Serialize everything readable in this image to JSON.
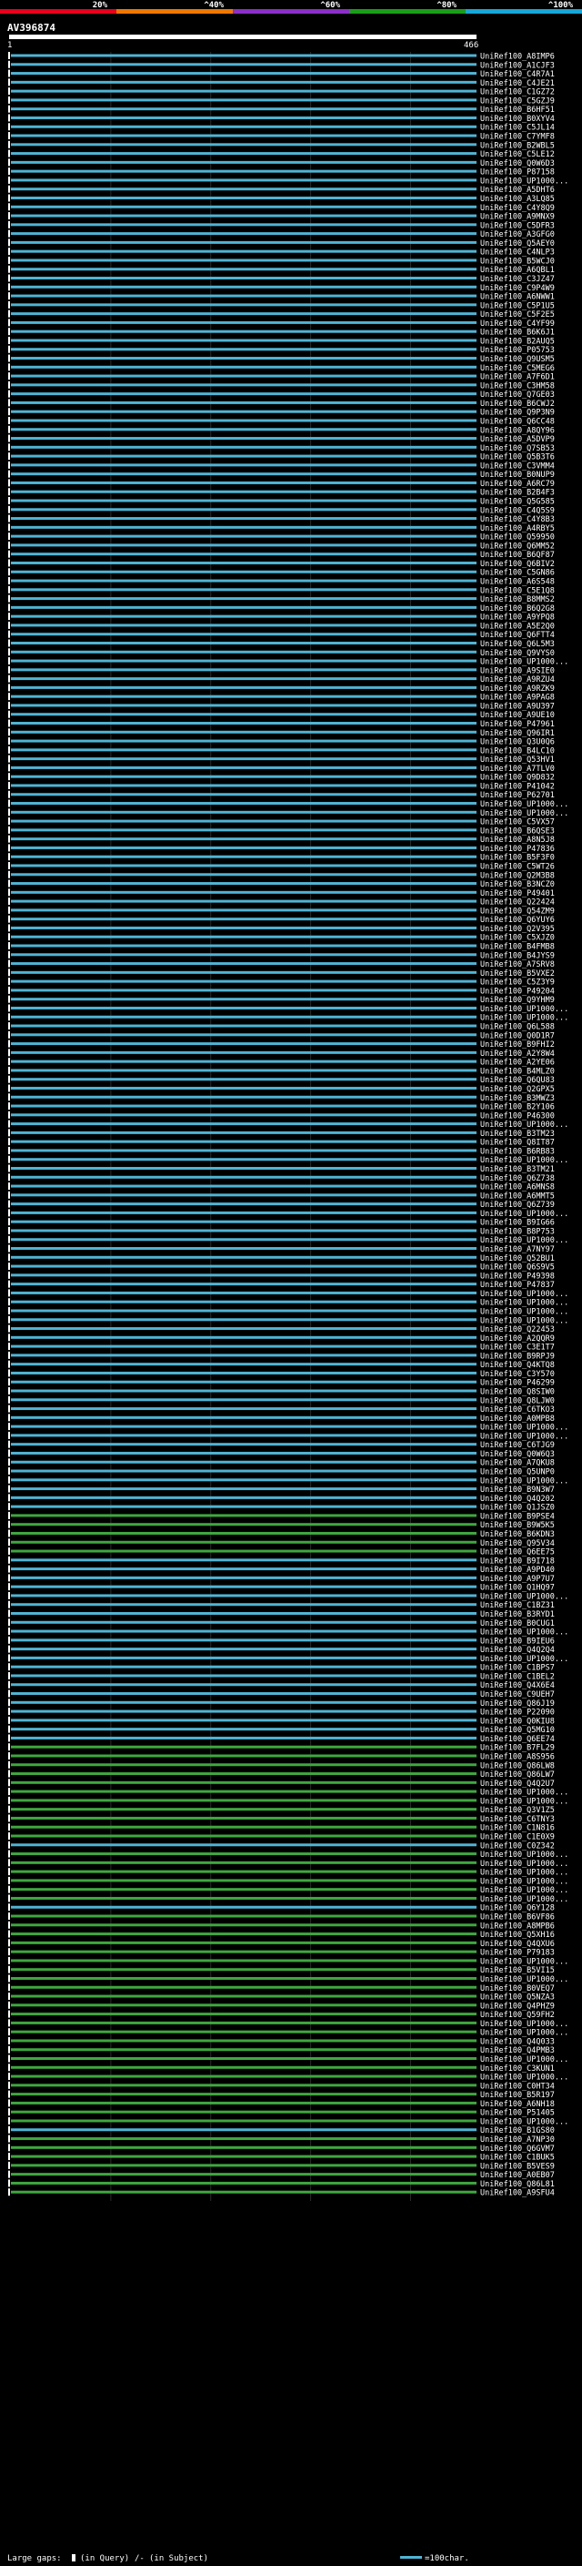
{
  "chart_data": {
    "type": "bar",
    "title": "AV396874",
    "query_start_label": "1",
    "query_end_label": "466",
    "query_length": 466,
    "identity_scale": {
      "labels": [
        "20%",
        "^40%",
        "^60%",
        "^80%",
        "^100%"
      ],
      "colors": [
        "#e8001c",
        "#f07800",
        "#8b2fc9",
        "#1a9e1a",
        "#16a8d8"
      ]
    },
    "bar_color_teal": "#4fb4d4",
    "bar_color_green": "#3fa73f",
    "bar_color_gray": "#9a9a9a",
    "legend": {
      "large_gaps": "Large gaps:",
      "in_query": "(in Query)",
      "in_subject": "(in Subject)",
      "scale": "=100char."
    },
    "hits": [
      {
        "label": "UniRef100_A8IMP6",
        "c": "t"
      },
      {
        "label": "UniRef100_A1CJF3",
        "c": "t"
      },
      {
        "label": "UniRef100_C4R7A1",
        "c": "t"
      },
      {
        "label": "UniRef100_C4JE21",
        "c": "t"
      },
      {
        "label": "UniRef100_C1GZ72",
        "c": "t"
      },
      {
        "label": "UniRef100_C5GZJ9",
        "c": "t"
      },
      {
        "label": "UniRef100_B6HF51",
        "c": "t"
      },
      {
        "label": "UniRef100_B0XYV4",
        "c": "t"
      },
      {
        "label": "UniRef100_C5JL14",
        "c": "t"
      },
      {
        "label": "UniRef100_C7YMF8",
        "c": "t"
      },
      {
        "label": "UniRef100_B2WBL5",
        "c": "t"
      },
      {
        "label": "UniRef100_C5LE12",
        "c": "t"
      },
      {
        "label": "UniRef100_Q0W6D3",
        "c": "t"
      },
      {
        "label": "UniRef100_P87158",
        "c": "t"
      },
      {
        "label": "UniRef100_UP1000...",
        "c": "t"
      },
      {
        "label": "UniRef100_A5DHT6",
        "c": "t"
      },
      {
        "label": "UniRef100_A3LQ85",
        "c": "t"
      },
      {
        "label": "UniRef100_C4Y8Q9",
        "c": "t"
      },
      {
        "label": "UniRef100_A9MNX9",
        "c": "t"
      },
      {
        "label": "UniRef100_C5DFR3",
        "c": "t"
      },
      {
        "label": "UniRef100_A3GFG0",
        "c": "t"
      },
      {
        "label": "UniRef100_Q5AEY0",
        "c": "t"
      },
      {
        "label": "UniRef100_C4NLP3",
        "c": "t"
      },
      {
        "label": "UniRef100_B5WCJ0",
        "c": "t"
      },
      {
        "label": "UniRef100_A6QBL1",
        "c": "t"
      },
      {
        "label": "UniRef100_C3JZ47",
        "c": "t"
      },
      {
        "label": "UniRef100_C9P4W9",
        "c": "t"
      },
      {
        "label": "UniRef100_A6NWW1",
        "c": "t"
      },
      {
        "label": "UniRef100_C5P1U5",
        "c": "t"
      },
      {
        "label": "UniRef100_C5F2E5",
        "c": "t"
      },
      {
        "label": "UniRef100_C4YF99",
        "c": "t"
      },
      {
        "label": "UniRef100_B6K6J1",
        "c": "t"
      },
      {
        "label": "UniRef100_B2AUQ5",
        "c": "t"
      },
      {
        "label": "UniRef100_P05753",
        "c": "t"
      },
      {
        "label": "UniRef100_Q9USM5",
        "c": "t"
      },
      {
        "label": "UniRef100_C5MEG6",
        "c": "t"
      },
      {
        "label": "UniRef100_A7F6D1",
        "c": "t"
      },
      {
        "label": "UniRef100_C3HM58",
        "c": "t"
      },
      {
        "label": "UniRef100_Q7GE03",
        "c": "t"
      },
      {
        "label": "UniRef100_B6CWJ2",
        "c": "t"
      },
      {
        "label": "UniRef100_Q9P3N9",
        "c": "t"
      },
      {
        "label": "UniRef100_Q6CC48",
        "c": "t"
      },
      {
        "label": "UniRef100_A8QY96",
        "c": "t"
      },
      {
        "label": "UniRef100_A5DVP9",
        "c": "t"
      },
      {
        "label": "UniRef100_Q7SB53",
        "c": "t"
      },
      {
        "label": "UniRef100_Q5B3T6",
        "c": "t"
      },
      {
        "label": "UniRef100_C3VMM4",
        "c": "t"
      },
      {
        "label": "UniRef100_B0NUP9",
        "c": "t"
      },
      {
        "label": "UniRef100_A6RC79",
        "c": "t"
      },
      {
        "label": "UniRef100_B2B4F3",
        "c": "t"
      },
      {
        "label": "UniRef100_Q5G585",
        "c": "t"
      },
      {
        "label": "UniRef100_C4Q5S9",
        "c": "t"
      },
      {
        "label": "UniRef100_C4Y8B3",
        "c": "t"
      },
      {
        "label": "UniRef100_A4RBY5",
        "c": "t"
      },
      {
        "label": "UniRef100_Q59950",
        "c": "t"
      },
      {
        "label": "UniRef100_Q6MM52",
        "c": "t"
      },
      {
        "label": "UniRef100_B6QF87",
        "c": "t"
      },
      {
        "label": "UniRef100_Q6BIV2",
        "c": "t"
      },
      {
        "label": "UniRef100_C5GN86",
        "c": "t"
      },
      {
        "label": "UniRef100_A6S548",
        "c": "t"
      },
      {
        "label": "UniRef100_C5E1Q8",
        "c": "t"
      },
      {
        "label": "UniRef100_B8MMS2",
        "c": "t"
      },
      {
        "label": "UniRef100_B6Q2G8",
        "c": "t"
      },
      {
        "label": "UniRef100_A9YPQ8",
        "c": "t"
      },
      {
        "label": "UniRef100_A5E2Q0",
        "c": "t"
      },
      {
        "label": "UniRef100_Q6FTT4",
        "c": "t"
      },
      {
        "label": "UniRef100_Q6L5M3",
        "c": "t"
      },
      {
        "label": "UniRef100_Q9VYS0",
        "c": "t"
      },
      {
        "label": "UniRef100_UP1000...",
        "c": "t"
      },
      {
        "label": "UniRef100_A9SIE0",
        "c": "t"
      },
      {
        "label": "UniRef100_A9RZU4",
        "c": "t"
      },
      {
        "label": "UniRef100_A9RZK9",
        "c": "t"
      },
      {
        "label": "UniRef100_A9PAG8",
        "c": "t"
      },
      {
        "label": "UniRef100_A9U397",
        "c": "t"
      },
      {
        "label": "UniRef100_A9UE10",
        "c": "t"
      },
      {
        "label": "UniRef100_P47961",
        "c": "t"
      },
      {
        "label": "UniRef100_Q96IR1",
        "c": "t"
      },
      {
        "label": "UniRef100_Q3U0Q6",
        "c": "t"
      },
      {
        "label": "UniRef100_B4LC10",
        "c": "t"
      },
      {
        "label": "UniRef100_Q53HV1",
        "c": "t"
      },
      {
        "label": "UniRef100_A7TLV0",
        "c": "t"
      },
      {
        "label": "UniRef100_Q9D832",
        "c": "t"
      },
      {
        "label": "UniRef100_P41042",
        "c": "t"
      },
      {
        "label": "UniRef100_P62701",
        "c": "t"
      },
      {
        "label": "UniRef100_UP1000...",
        "c": "t"
      },
      {
        "label": "UniRef100_UP1000...",
        "c": "t"
      },
      {
        "label": "UniRef100_C5VX57",
        "c": "t"
      },
      {
        "label": "UniRef100_B6QSE3",
        "c": "t"
      },
      {
        "label": "UniRef100_A8N5J8",
        "c": "t"
      },
      {
        "label": "UniRef100_P47836",
        "c": "t"
      },
      {
        "label": "UniRef100_B5F3F0",
        "c": "t"
      },
      {
        "label": "UniRef100_C5WT26",
        "c": "t"
      },
      {
        "label": "UniRef100_Q2M3B8",
        "c": "t"
      },
      {
        "label": "UniRef100_B3NCZ0",
        "c": "t"
      },
      {
        "label": "UniRef100_P49401",
        "c": "t"
      },
      {
        "label": "UniRef100_Q22424",
        "c": "t"
      },
      {
        "label": "UniRef100_Q54ZM9",
        "c": "t"
      },
      {
        "label": "UniRef100_Q6YUY6",
        "c": "t"
      },
      {
        "label": "UniRef100_Q2V395",
        "c": "t"
      },
      {
        "label": "UniRef100_C5XJZ0",
        "c": "t"
      },
      {
        "label": "UniRef100_B4FMB8",
        "c": "t"
      },
      {
        "label": "UniRef100_B4JYS9",
        "c": "t"
      },
      {
        "label": "UniRef100_A7SRV8",
        "c": "t"
      },
      {
        "label": "UniRef100_B5VXE2",
        "c": "t"
      },
      {
        "label": "UniRef100_C5Z3Y9",
        "c": "t"
      },
      {
        "label": "UniRef100_P49204",
        "c": "t"
      },
      {
        "label": "UniRef100_Q9YHM9",
        "c": "t"
      },
      {
        "label": "UniRef100_UP1000...",
        "c": "t"
      },
      {
        "label": "UniRef100_UP1000...",
        "c": "t"
      },
      {
        "label": "UniRef100_Q6L588",
        "c": "t"
      },
      {
        "label": "UniRef100_Q0D1R7",
        "c": "t"
      },
      {
        "label": "UniRef100_B9FHI2",
        "c": "t"
      },
      {
        "label": "UniRef100_A2Y8W4",
        "c": "t"
      },
      {
        "label": "UniRef100_A2YE06",
        "c": "t"
      },
      {
        "label": "UniRef100_B4MLZ0",
        "c": "t"
      },
      {
        "label": "UniRef100_Q6QU83",
        "c": "t"
      },
      {
        "label": "UniRef100_Q2GPX5",
        "c": "t"
      },
      {
        "label": "UniRef100_B3MWZ3",
        "c": "t"
      },
      {
        "label": "UniRef100_B2Y106",
        "c": "t"
      },
      {
        "label": "UniRef100_P46300",
        "c": "t"
      },
      {
        "label": "UniRef100_UP1000...",
        "c": "t"
      },
      {
        "label": "UniRef100_B3TM23",
        "c": "t"
      },
      {
        "label": "UniRef100_Q8IT87",
        "c": "t"
      },
      {
        "label": "UniRef100_B6RB83",
        "c": "t"
      },
      {
        "label": "UniRef100_UP1000...",
        "c": "t"
      },
      {
        "label": "UniRef100_B3TM21",
        "c": "t"
      },
      {
        "label": "UniRef100_Q6Z738",
        "c": "t"
      },
      {
        "label": "UniRef100_A6MNS8",
        "c": "t"
      },
      {
        "label": "UniRef100_A6MMT5",
        "c": "t"
      },
      {
        "label": "UniRef100_Q6Z739",
        "c": "t"
      },
      {
        "label": "UniRef100_UP1000...",
        "c": "t"
      },
      {
        "label": "UniRef100_B9IG66",
        "c": "t"
      },
      {
        "label": "UniRef100_B8P753",
        "c": "t"
      },
      {
        "label": "UniRef100_UP1000...",
        "c": "t"
      },
      {
        "label": "UniRef100_A7NY97",
        "c": "t"
      },
      {
        "label": "UniRef100_Q52BU1",
        "c": "t"
      },
      {
        "label": "UniRef100_Q6S9V5",
        "c": "t"
      },
      {
        "label": "UniRef100_P49398",
        "c": "t"
      },
      {
        "label": "UniRef100_P47837",
        "c": "t"
      },
      {
        "label": "UniRef100_UP1000...",
        "c": "t"
      },
      {
        "label": "UniRef100_UP1000...",
        "c": "t"
      },
      {
        "label": "UniRef100_UP1000...",
        "c": "t"
      },
      {
        "label": "UniRef100_UP1000...",
        "c": "t"
      },
      {
        "label": "UniRef100_Q22453",
        "c": "t"
      },
      {
        "label": "UniRef100_A2QQR9",
        "c": "t"
      },
      {
        "label": "UniRef100_C3E1T7",
        "c": "t"
      },
      {
        "label": "UniRef100_B9RPJ9",
        "c": "t"
      },
      {
        "label": "UniRef100_Q4KTQ8",
        "c": "t"
      },
      {
        "label": "UniRef100_C3Y570",
        "c": "t"
      },
      {
        "label": "UniRef100_P46299",
        "c": "t"
      },
      {
        "label": "UniRef100_Q8SIW0",
        "c": "t"
      },
      {
        "label": "UniRef100_Q8LJW0",
        "c": "t"
      },
      {
        "label": "UniRef100_C6TKO3",
        "c": "t"
      },
      {
        "label": "UniRef100_A0MPB8",
        "c": "t"
      },
      {
        "label": "UniRef100_UP1000...",
        "c": "t"
      },
      {
        "label": "UniRef100_UP1000...",
        "c": "t"
      },
      {
        "label": "UniRef100_C6TJG9",
        "c": "t"
      },
      {
        "label": "UniRef100_Q0W6Q3",
        "c": "t"
      },
      {
        "label": "UniRef100_A7QKU8",
        "c": "t"
      },
      {
        "label": "UniRef100_Q5UNP0",
        "c": "t"
      },
      {
        "label": "UniRef100_UP1000...",
        "c": "t"
      },
      {
        "label": "UniRef100_B9N3W7",
        "c": "t"
      },
      {
        "label": "UniRef100_Q4Q202",
        "c": "t"
      },
      {
        "label": "UniRef100_Q1JSZ0",
        "c": "t"
      },
      {
        "label": "UniRef100_B9PSE4",
        "c": "g"
      },
      {
        "label": "UniRef100_B9W5K5",
        "c": "g"
      },
      {
        "label": "UniRef100_B6KDN3",
        "c": "g"
      },
      {
        "label": "UniRef100_Q95V34",
        "c": "g"
      },
      {
        "label": "UniRef100_Q6EE75",
        "c": "g"
      },
      {
        "label": "UniRef100_B9I718",
        "c": "t"
      },
      {
        "label": "UniRef100_A9PD40",
        "c": "t"
      },
      {
        "label": "UniRef100_A9P7U7",
        "c": "t"
      },
      {
        "label": "UniRef100_Q1HQ97",
        "c": "t"
      },
      {
        "label": "UniRef100_UP1000...",
        "c": "t"
      },
      {
        "label": "UniRef100_C1BZ31",
        "c": "t"
      },
      {
        "label": "UniRef100_B3RYD1",
        "c": "t"
      },
      {
        "label": "UniRef100_B0CUG1",
        "c": "t"
      },
      {
        "label": "UniRef100_UP1000...",
        "c": "t"
      },
      {
        "label": "UniRef100_B9IEU6",
        "c": "t"
      },
      {
        "label": "UniRef100_Q4Q2Q4",
        "c": "t"
      },
      {
        "label": "UniRef100_UP1000...",
        "c": "t"
      },
      {
        "label": "UniRef100_C1BPS7",
        "c": "t"
      },
      {
        "label": "UniRef100_C1BEL2",
        "c": "t"
      },
      {
        "label": "UniRef100_Q4X6E4",
        "c": "t"
      },
      {
        "label": "UniRef100_C9UEH7",
        "c": "t"
      },
      {
        "label": "UniRef100_Q86J19",
        "c": "t"
      },
      {
        "label": "UniRef100_P22090",
        "c": "t"
      },
      {
        "label": "UniRef100_Q0KIU8",
        "c": "t"
      },
      {
        "label": "UniRef100_Q5MG10",
        "c": "t"
      },
      {
        "label": "UniRef100_Q6EE74",
        "c": "t"
      },
      {
        "label": "UniRef100_B7FL29",
        "c": "g"
      },
      {
        "label": "UniRef100_A8S956",
        "c": "g"
      },
      {
        "label": "UniRef100_Q86LW8",
        "c": "g"
      },
      {
        "label": "UniRef100_Q86LW7",
        "c": "g"
      },
      {
        "label": "UniRef100_Q4Q2U7",
        "c": "g"
      },
      {
        "label": "UniRef100_UP1000...",
        "c": "g"
      },
      {
        "label": "UniRef100_UP1000...",
        "c": "g"
      },
      {
        "label": "UniRef100_Q3V1Z5",
        "c": "g"
      },
      {
        "label": "UniRef100_C6TNY3",
        "c": "g"
      },
      {
        "label": "UniRef100_C1N816",
        "c": "g"
      },
      {
        "label": "UniRef100_C1E0X9",
        "c": "g"
      },
      {
        "label": "UniRef100_C0Z342",
        "c": "t"
      },
      {
        "label": "UniRef100_UP1000...",
        "c": "g"
      },
      {
        "label": "UniRef100_UP1000...",
        "c": "g"
      },
      {
        "label": "UniRef100_UP1000...",
        "c": "g"
      },
      {
        "label": "UniRef100_UP1000...",
        "c": "g"
      },
      {
        "label": "UniRef100_UP1000...",
        "c": "g"
      },
      {
        "label": "UniRef100_UP1000...",
        "c": "g"
      },
      {
        "label": "UniRef100_Q6Y128",
        "c": "t"
      },
      {
        "label": "UniRef100_B6VF86",
        "c": "g"
      },
      {
        "label": "UniRef100_A8MPB6",
        "c": "g"
      },
      {
        "label": "UniRef100_Q5XH16",
        "c": "g"
      },
      {
        "label": "UniRef100_Q4QXU6",
        "c": "g"
      },
      {
        "label": "UniRef100_P79183",
        "c": "g"
      },
      {
        "label": "UniRef100_UP1000...",
        "c": "g"
      },
      {
        "label": "UniRef100_B5VI15",
        "c": "g"
      },
      {
        "label": "UniRef100_UP1000...",
        "c": "g"
      },
      {
        "label": "UniRef100_B0VEQ7",
        "c": "g"
      },
      {
        "label": "UniRef100_Q5NZA3",
        "c": "g"
      },
      {
        "label": "UniRef100_Q4PHZ9",
        "c": "g"
      },
      {
        "label": "UniRef100_Q59FH2",
        "c": "g"
      },
      {
        "label": "UniRef100_UP1000...",
        "c": "g"
      },
      {
        "label": "UniRef100_UP1000...",
        "c": "g"
      },
      {
        "label": "UniRef100_Q4Q033",
        "c": "g"
      },
      {
        "label": "UniRef100_Q4PMB3",
        "c": "g"
      },
      {
        "label": "UniRef100_UP1000...",
        "c": "g"
      },
      {
        "label": "UniRef100_C3KUN1",
        "c": "g"
      },
      {
        "label": "UniRef100_UP1000...",
        "c": "g"
      },
      {
        "label": "UniRef100_C0HT34",
        "c": "g"
      },
      {
        "label": "UniRef100_B5R197",
        "c": "g"
      },
      {
        "label": "UniRef100_A6NH18",
        "c": "g"
      },
      {
        "label": "UniRef100_P51405",
        "c": "g"
      },
      {
        "label": "UniRef100_UP1000...",
        "c": "g"
      },
      {
        "label": "UniRef100_B1GS80",
        "c": "t"
      },
      {
        "label": "UniRef100_A7NP30",
        "c": "g"
      },
      {
        "label": "UniRef100_Q6GVM7",
        "c": "g"
      },
      {
        "label": "UniRef100_C1BUK5",
        "c": "g"
      },
      {
        "label": "UniRef100_B5VES9",
        "c": "g"
      },
      {
        "label": "UniRef100_A0EB07",
        "c": "g"
      },
      {
        "label": "UniRef100_Q86L81",
        "c": "g"
      },
      {
        "label": "UniRef100_A9SFU4",
        "c": "g"
      }
    ]
  }
}
